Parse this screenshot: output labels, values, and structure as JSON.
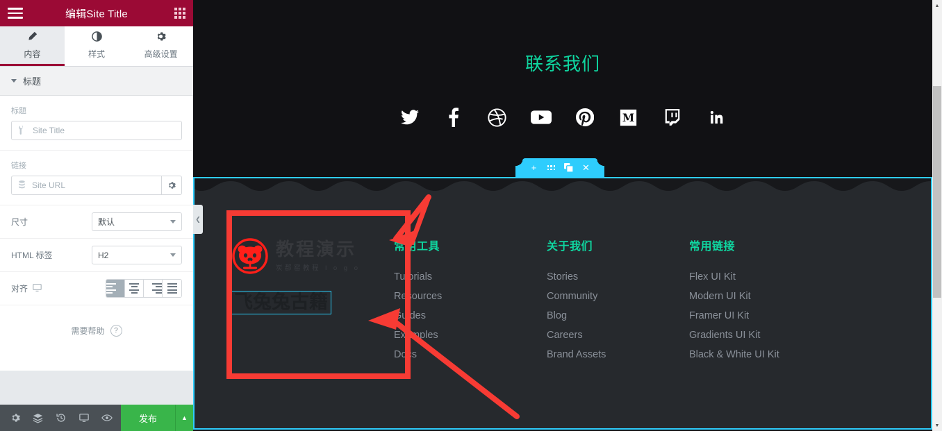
{
  "panel": {
    "header": {
      "title": "编辑Site Title",
      "menu_icon": "hamburger-icon",
      "apps_icon": "grid-apps-icon"
    },
    "tabs": [
      {
        "label": "内容",
        "icon": "pencil-icon",
        "active": true
      },
      {
        "label": "样式",
        "icon": "contrast-icon",
        "active": false
      },
      {
        "label": "高级设置",
        "icon": "gear-icon",
        "active": false
      }
    ],
    "section": {
      "label": "标题",
      "collapse_icon": "caret-down-icon"
    },
    "controls": {
      "title_label": "标题",
      "title_value": "",
      "title_placeholder": "Site Title",
      "title_icon": "wrench-icon",
      "link_label": "链接",
      "link_value": "",
      "link_placeholder": "Site URL",
      "link_icon": "database-icon",
      "link_settings_icon": "gear-icon",
      "size_label": "尺寸",
      "size_value": "默认",
      "html_tag_label": "HTML 标签",
      "html_tag_value": "H2",
      "align_label": "对齐",
      "align_device_icon": "desktop-icon",
      "align_options": [
        "left",
        "center",
        "right",
        "justify"
      ],
      "align_selected": 0
    },
    "help": {
      "text": "需要帮助",
      "icon": "question-circle-icon"
    },
    "footer": {
      "icons": [
        "gear-icon",
        "layers-icon",
        "history-icon",
        "desktop-preview-icon",
        "eye-icon"
      ],
      "publish_label": "发布",
      "publish_arrow_icon": "caret-up-icon"
    },
    "collapse_handle_icon": "chevron-left-icon"
  },
  "canvas": {
    "contact_section": {
      "title": "联系我们",
      "title_color": "#0fd6a0",
      "socials": [
        {
          "name": "twitter-icon"
        },
        {
          "name": "facebook-icon"
        },
        {
          "name": "dribbble-icon"
        },
        {
          "name": "youtube-icon"
        },
        {
          "name": "pinterest-icon"
        },
        {
          "name": "medium-icon"
        },
        {
          "name": "twitch-icon"
        },
        {
          "name": "linkedin-icon"
        }
      ]
    },
    "element_toolbar": {
      "buttons": [
        {
          "name": "add-section-button",
          "glyph": "+"
        },
        {
          "name": "drag-handle-button",
          "glyph": "dots"
        },
        {
          "name": "duplicate-button",
          "glyph": "copy"
        },
        {
          "name": "delete-button",
          "glyph": "×"
        }
      ],
      "accent_color": "#2ecdfd"
    },
    "footer_section": {
      "selected_outline_color": "#2ecdfd",
      "brand": {
        "logo_name": "panda-circle-logo",
        "logo_color": "#ff1f19",
        "logo_main_text": "教程演示",
        "logo_sub_text": "炭郡窑教程 l o g o",
        "site_title": "飞兔兔古籍"
      },
      "columns": [
        {
          "title": "常用工具",
          "links": [
            "Tutorials",
            "Resources",
            "Guides",
            "Examples",
            "Docs"
          ]
        },
        {
          "title": "关于我们",
          "links": [
            "Stories",
            "Community",
            "Blog",
            "Careers",
            "Brand Assets"
          ]
        },
        {
          "title": "常用链接",
          "links": [
            "Flex UI Kit",
            "Modern UI Kit",
            "Framer UI Kit",
            "Gradients UI Kit",
            "Black & White UI Kit"
          ]
        }
      ]
    }
  },
  "annotations": {
    "highlight_color": "#f73b34",
    "boxes": [
      {
        "name": "brand-area-highlight-box"
      }
    ],
    "arrows": [
      {
        "name": "arrow-to-brand-area"
      },
      {
        "name": "arrow-to-site-title"
      }
    ]
  },
  "scrollbar": {
    "up_icon": "caret-up-icon",
    "down_icon": "caret-down-icon"
  }
}
